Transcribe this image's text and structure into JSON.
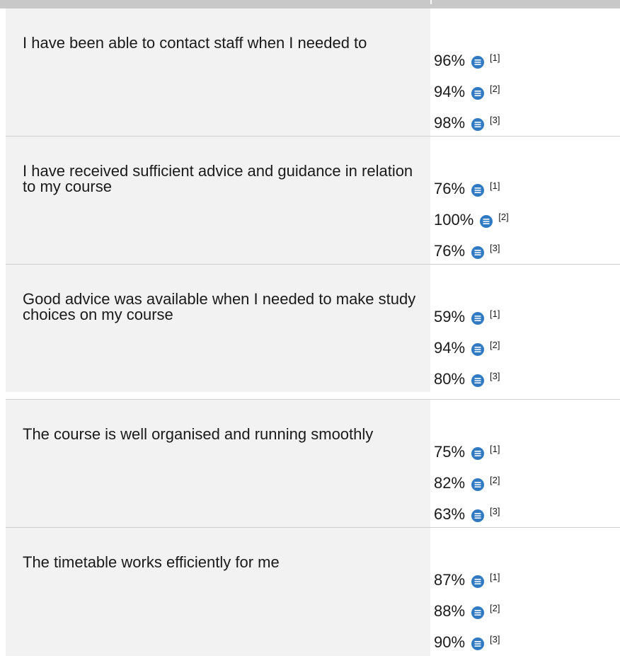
{
  "icon": {
    "name": "note-icon",
    "color": "#2f7ac2",
    "lines_color": "#ffffff"
  },
  "questions": [
    {
      "text": "I have been able to contact staff when I needed to",
      "answers": [
        {
          "pct": "96%",
          "ref": "[1]"
        },
        {
          "pct": "94%",
          "ref": "[2]"
        },
        {
          "pct": "98%",
          "ref": "[3]"
        }
      ]
    },
    {
      "text": "I have received sufficient advice and guidance in relation to my course",
      "answers": [
        {
          "pct": "76%",
          "ref": "[1]"
        },
        {
          "pct": "100%",
          "ref": "[2]"
        },
        {
          "pct": "76%",
          "ref": "[3]"
        }
      ]
    },
    {
      "text": "Good advice was available when I needed to make study choices on my course",
      "answers": [
        {
          "pct": "59%",
          "ref": "[1]"
        },
        {
          "pct": "94%",
          "ref": "[2]"
        },
        {
          "pct": "80%",
          "ref": "[3]"
        }
      ]
    },
    {
      "text": "The course is well organised and running smoothly",
      "answers": [
        {
          "pct": "75%",
          "ref": "[1]"
        },
        {
          "pct": "82%",
          "ref": "[2]"
        },
        {
          "pct": "63%",
          "ref": "[3]"
        }
      ]
    },
    {
      "text": "The timetable works efficiently for me",
      "answers": [
        {
          "pct": "87%",
          "ref": "[1]"
        },
        {
          "pct": "88%",
          "ref": "[2]"
        },
        {
          "pct": "90%",
          "ref": "[3]"
        }
      ]
    }
  ]
}
